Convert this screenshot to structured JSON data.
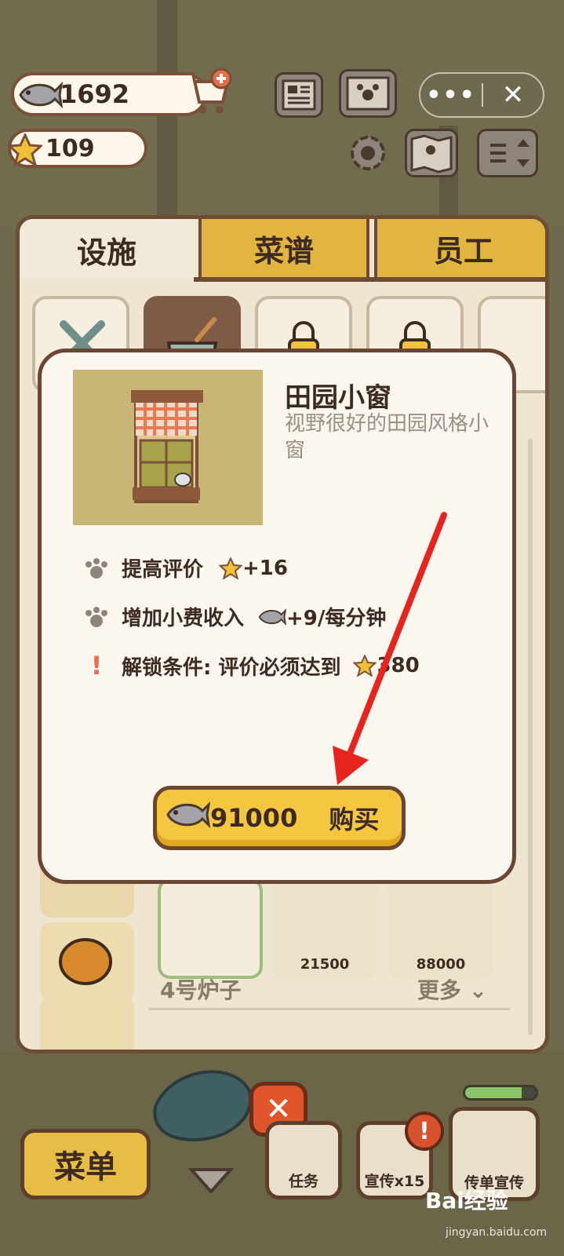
{
  "hud": {
    "fish_coins": "1692",
    "stars": "109",
    "icons": [
      "fish-coin-icon",
      "cart-plus-icon",
      "star-icon",
      "newspaper-icon",
      "paw-book-icon",
      "gear-icon",
      "map-icon",
      "sort-icon"
    ]
  },
  "wx_capsule": {
    "more": "•••",
    "close": "✕"
  },
  "tabs": [
    "设施",
    "菜谱",
    "员工"
  ],
  "modal": {
    "title": "田园小窗",
    "description": "视野很好的田园风格小窗",
    "stats": [
      {
        "icon": "paw-icon",
        "label": "提高评价",
        "value_icon": "star-icon",
        "value": "+16"
      },
      {
        "icon": "paw-icon",
        "label": "增加小费收入",
        "value_icon": "fish-icon",
        "value": "+9/每分钟"
      },
      {
        "icon": "exclamation-icon",
        "label": "解锁条件: 评价必须达到",
        "value_icon": "star-icon",
        "value": "380"
      }
    ],
    "buy": {
      "price": "91000",
      "label": "购买"
    }
  },
  "shop": {
    "items": [
      {
        "price": ""
      },
      {
        "price": "21500"
      },
      {
        "price": "88000"
      }
    ],
    "section_title": "4号炉子",
    "more": "更多"
  },
  "bottom": {
    "menu": "菜单",
    "task": "任务",
    "promo": "宣传x15",
    "flyer": "传单宣传",
    "close": "✕",
    "alert": "!"
  },
  "progress": 0.8,
  "watermark": {
    "brand": "Bai经验",
    "url": "jingyan.baidu.com"
  },
  "colors": {
    "accent": "#f5c741",
    "panel_border": "#6b4632",
    "arrow": "#e8241f"
  }
}
